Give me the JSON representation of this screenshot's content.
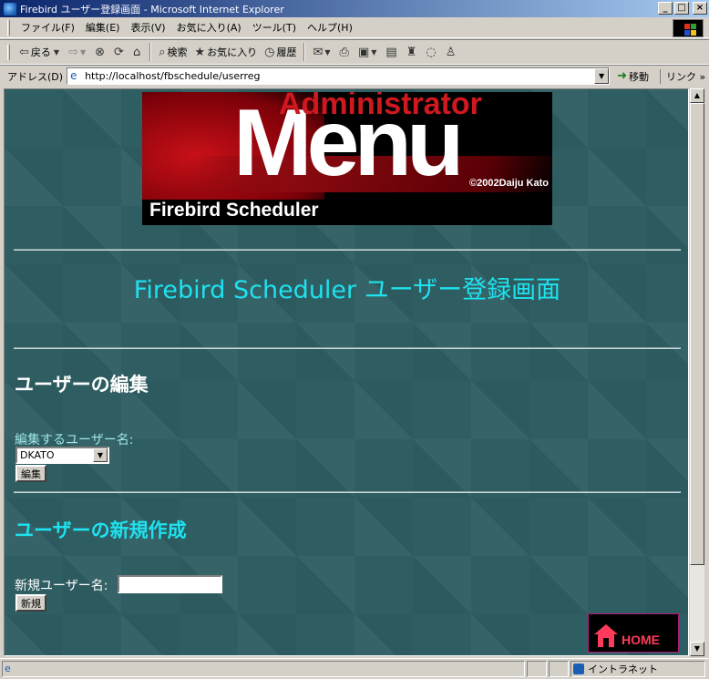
{
  "window": {
    "title": "Firebird ユーザー登録画面 - Microsoft Internet Explorer",
    "minimize": "_",
    "maximize": "□",
    "close": "×"
  },
  "menu": [
    "ファイル(F)",
    "編集(E)",
    "表示(V)",
    "お気に入り(A)",
    "ツール(T)",
    "ヘルプ(H)"
  ],
  "toolbar": {
    "back": "戻る",
    "search": "検索",
    "favorites": "お気に入り",
    "history": "履歴"
  },
  "address": {
    "label": "アドレス(D)",
    "url": "http://localhost/fbschedule/userreg",
    "go": "移動",
    "links": "リンク »"
  },
  "banner": {
    "admin": "Administrator",
    "menu": "Menu",
    "copyright": "©2002Daiju Kato",
    "product": "Firebird Scheduler"
  },
  "page": {
    "title": "Firebird Scheduler ユーザー登録画面",
    "edit_heading": "ユーザーの編集",
    "edit_label": "編集するユーザー名:",
    "edit_select_value": "DKATO",
    "edit_button": "編集",
    "new_heading": "ユーザーの新規作成",
    "new_label": "新規ユーザー名:",
    "new_input_value": "",
    "new_button": "新規",
    "home_label": "HOME"
  },
  "status": {
    "zone": "イントラネット"
  },
  "colors": {
    "background": "#2f5e62",
    "title_cyan": "#1ee2ef",
    "banner_red": "#d01820"
  }
}
